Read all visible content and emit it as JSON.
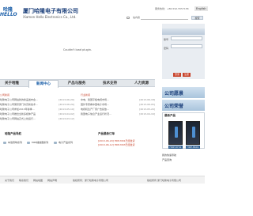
{
  "header": {
    "logo_cn": "哈隆",
    "logo_en": "HELLO",
    "company_cn": "厦门哈隆电子有限公司",
    "company_en": "Xiamen Hello Electronics Co., Ltd.",
    "hotline": "服务热线：+86-592-5557158",
    "lang_label": "English",
    "search_label": "站内搜",
    "search_button": "搜索"
  },
  "banner": {
    "plugin_message": "Couldn't load plugin.",
    "login_labels": [
      "账号",
      "密码"
    ],
    "login_buttons": [
      "登录",
      "注册"
    ]
  },
  "nav": {
    "items": [
      "关于哈隆",
      "新闻中心",
      "产品与服务",
      "技术支持",
      "人力资源"
    ],
    "active_index": 1
  },
  "news": {
    "company_title": "公司新闻",
    "company_items": [
      {
        "title": "哈隆电子公司网站新的新品发布会…",
        "date": "[2013-06-20]"
      },
      {
        "title": "哈隆电子公司荣获厦门市高新技术…",
        "date": "[2013-06-20]"
      },
      {
        "title": "哈隆电子公司参加2013年春季…",
        "date": "[2013-05-10]"
      },
      {
        "title": "哈隆电子公司推出全新多媒体产品",
        "date": "[2013-04-02]"
      },
      {
        "title": "哈隆电子公司网站正式上线运行…",
        "date": "[2013-03-12]"
      }
    ],
    "industry_title": "行业新闻",
    "industry_items": [
      {
        "title": "中电、我国平板电视市场…",
        "date": "[2013-06-18]"
      },
      {
        "title": "国外专家看中国电子市场…",
        "date": "[2013-06-05]"
      },
      {
        "title": "电视机生产厂家广告投放…",
        "date": "[2013-05-20]"
      },
      {
        "title": "我国电子信息产业运行状况…",
        "date": "[2013-04-16]"
      }
    ]
  },
  "products": {
    "nav_title": "哈隆产品导航",
    "nav_items": [
      "车载音响系列",
      "MP4播放器系列",
      "电子产品系列"
    ],
    "latest_title": "产品最新订单",
    "latest_items": [
      "[2013-06-20] HDP-M01已经发货",
      "[2013-06-12] HDP-M03已经发货"
    ]
  },
  "sidebar": {
    "promo1": "公司愿景",
    "promo2": "公司荣誉",
    "rec_title": "最新产品",
    "rec_products": [
      "HDP-8701",
      "HDP-8601"
    ],
    "links": [
      "我的快速导航",
      "产品咨询"
    ]
  },
  "footer": {
    "links": [
      "关于我们",
      "联系我们",
      "网站地图",
      "网站声明"
    ],
    "copyright": "版权所有：厦门哈隆电子有限公司",
    "right_text": "版权所有 厦门哈隆电子有限公司"
  }
}
